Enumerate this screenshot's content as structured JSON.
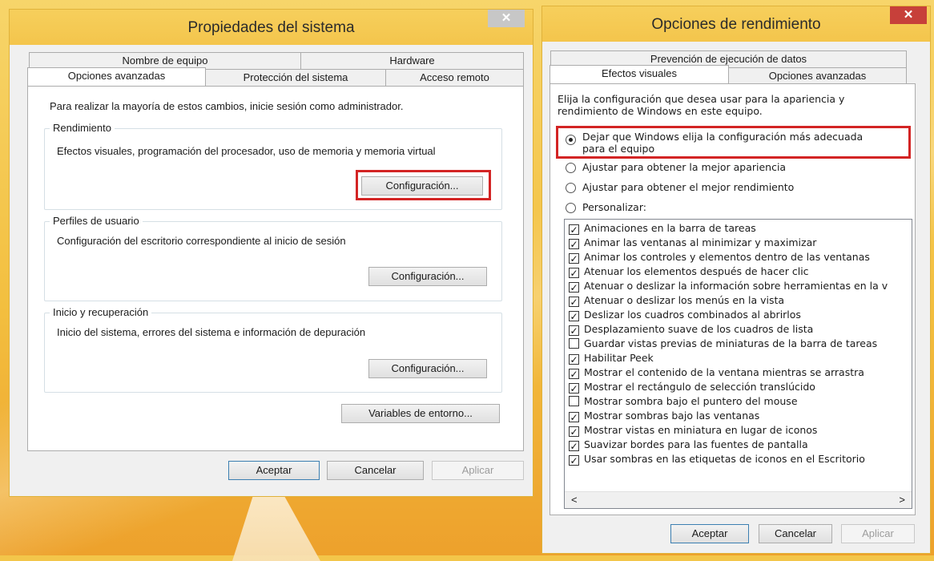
{
  "left_window": {
    "title": "Propiedades del sistema",
    "close": "✕",
    "tabs_row1": [
      "Nombre de equipo",
      "Hardware"
    ],
    "tabs_row2": [
      "Opciones avanzadas",
      "Protección del sistema",
      "Acceso remoto"
    ],
    "admin_notice": "Para realizar la mayoría de estos cambios, inicie sesión como administrador.",
    "groups": [
      {
        "label": "Rendimiento",
        "desc": "Efectos visuales, programación del procesador, uso de memoria y memoria virtual",
        "button": "Configuración..."
      },
      {
        "label": "Perfiles de usuario",
        "desc": "Configuración del escritorio correspondiente al inicio de sesión",
        "button": "Configuración..."
      },
      {
        "label": "Inicio y recuperación",
        "desc": "Inicio del sistema, errores del sistema e información de depuración",
        "button": "Configuración..."
      }
    ],
    "env_button": "Variables de entorno...",
    "footer": {
      "ok": "Aceptar",
      "cancel": "Cancelar",
      "apply": "Aplicar"
    }
  },
  "right_window": {
    "title": "Opciones de rendimiento",
    "close": "✕",
    "tab_top": "Prevención de ejecución de datos",
    "tabs": [
      "Efectos visuales",
      "Opciones avanzadas"
    ],
    "intro": "Elija la configuración que desea usar para la apariencia y rendimiento de Windows en este equipo.",
    "radios": [
      {
        "label_line1": "Dejar que Windows elija la configuración más adecuada",
        "label_line2": "para el equipo",
        "checked": true
      },
      {
        "label_line1": "Ajustar para obtener la mejor apariencia",
        "checked": false
      },
      {
        "label_line1": "Ajustar para obtener el mejor rendimiento",
        "checked": false
      },
      {
        "label_line1": "Personalizar:",
        "checked": false
      }
    ],
    "effects": [
      {
        "label": "Animaciones en la barra de tareas",
        "checked": true
      },
      {
        "label": "Animar las ventanas al minimizar y maximizar",
        "checked": true
      },
      {
        "label": "Animar los controles y elementos dentro de las ventanas",
        "checked": true
      },
      {
        "label": "Atenuar los elementos después de hacer clic",
        "checked": true
      },
      {
        "label": "Atenuar o deslizar la información sobre herramientas en la v",
        "checked": true
      },
      {
        "label": "Atenuar o deslizar los menús en la vista",
        "checked": true
      },
      {
        "label": "Deslizar los cuadros combinados al abrirlos",
        "checked": true
      },
      {
        "label": "Desplazamiento suave de los cuadros de lista",
        "checked": true
      },
      {
        "label": "Guardar vistas previas de miniaturas de la barra de tareas",
        "checked": false
      },
      {
        "label": "Habilitar Peek",
        "checked": true
      },
      {
        "label": "Mostrar el contenido de la ventana mientras se arrastra",
        "checked": true
      },
      {
        "label": "Mostrar el rectángulo de selección translúcido",
        "checked": true
      },
      {
        "label": "Mostrar sombra bajo el puntero del mouse",
        "checked": false
      },
      {
        "label": "Mostrar sombras bajo las ventanas",
        "checked": true
      },
      {
        "label": "Mostrar vistas en miniatura en lugar de iconos",
        "checked": true
      },
      {
        "label": "Suavizar bordes para las fuentes de pantalla",
        "checked": true
      },
      {
        "label": "Usar sombras en las etiquetas de iconos en el Escritorio",
        "checked": true
      }
    ],
    "scroll_left": "<",
    "scroll_right": ">",
    "footer": {
      "ok": "Aceptar",
      "cancel": "Cancelar",
      "apply": "Aplicar"
    }
  },
  "colors": {
    "highlight": "#d32424",
    "title_bar": "#f4c54c",
    "close_active": "#c7403a"
  }
}
